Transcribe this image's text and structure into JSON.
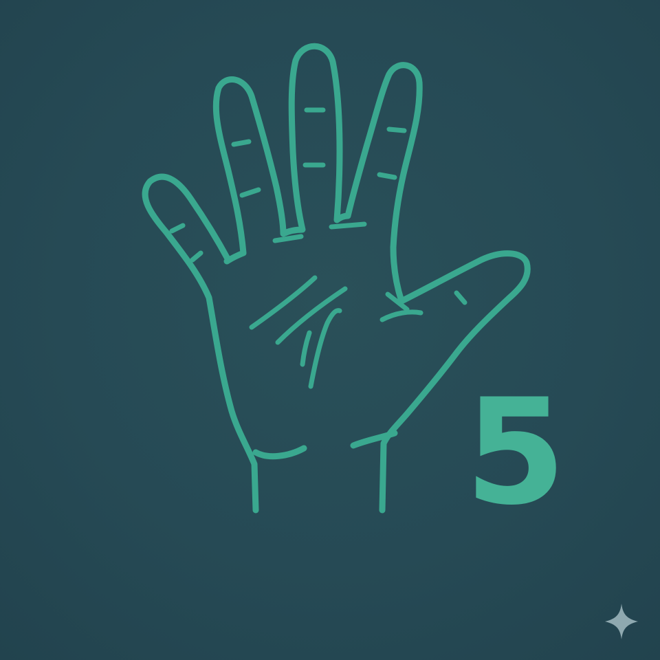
{
  "illustration": {
    "subject": "open-hand-icon",
    "number": "5"
  },
  "colors": {
    "background": "#264a55",
    "line": "#3aa88f",
    "number": "#45b296",
    "sparkle": "#8fa9b0"
  },
  "watermark": {
    "icon": "sparkle-icon"
  }
}
